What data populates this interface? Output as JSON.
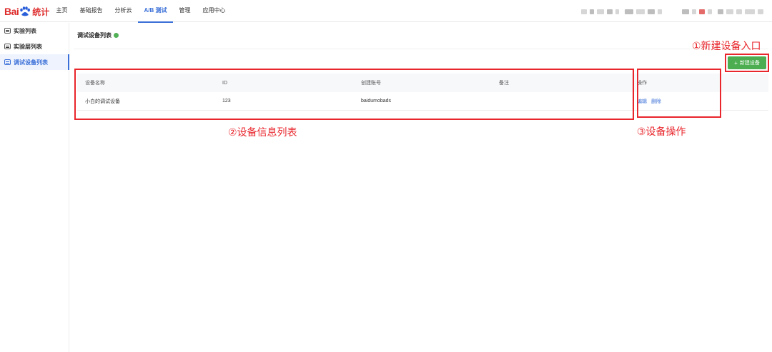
{
  "logo": {
    "text_bai": "Bai",
    "text_tj": "统计"
  },
  "nav": {
    "items": [
      {
        "label": "主页"
      },
      {
        "label": "基础报告"
      },
      {
        "label": "分析云"
      },
      {
        "label": "A/B 测试"
      },
      {
        "label": "管理"
      },
      {
        "label": "应用中心"
      }
    ],
    "active_index": 3
  },
  "sidebar": {
    "items": [
      {
        "label": "实验列表"
      },
      {
        "label": "实验层列表"
      },
      {
        "label": "调试设备列表"
      }
    ],
    "active_index": 2
  },
  "page": {
    "title": "调试设备列表"
  },
  "toolbar": {
    "new_device_label": "新建设备",
    "plus": "+"
  },
  "table": {
    "headers": [
      "设备名称",
      "ID",
      "创建账号",
      "备注",
      "操作"
    ],
    "rows": [
      {
        "name": "小白的调试设备",
        "id": "123",
        "account": "baidumobads",
        "note": "",
        "actions": [
          "编辑",
          "删除"
        ]
      }
    ]
  },
  "annotations": {
    "new_entry": "①新建设备入口",
    "info_list": "②设备信息列表",
    "operations": "③设备操作"
  },
  "colors": {
    "accent": "#3a6fd8",
    "primary_button": "#4cae50",
    "annotation": "#e8262c",
    "logo": "#de2d2d"
  }
}
